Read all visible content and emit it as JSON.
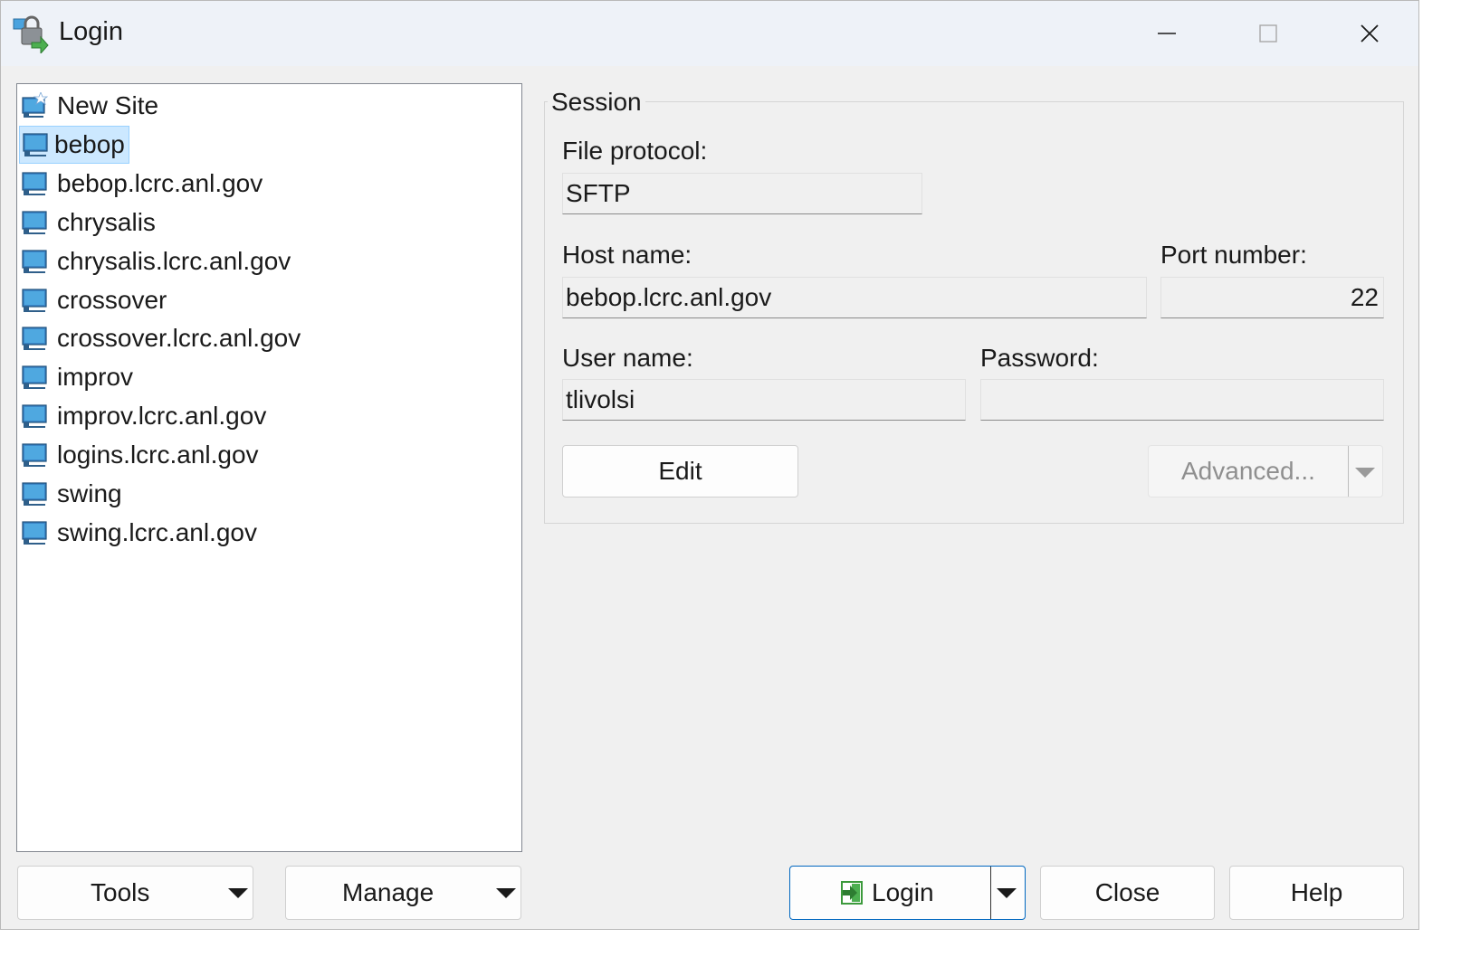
{
  "window": {
    "title": "Login",
    "minimize_icon": "minimize-icon",
    "maximize_icon": "maximize-icon",
    "close_icon": "close-icon"
  },
  "site_tree": {
    "items": [
      {
        "label": "New Site",
        "icon": "new-site-icon"
      },
      {
        "label": "bebop",
        "icon": "computer-icon",
        "selected": true
      },
      {
        "label": "bebop.lcrc.anl.gov",
        "icon": "computer-icon"
      },
      {
        "label": "chrysalis",
        "icon": "computer-icon"
      },
      {
        "label": "chrysalis.lcrc.anl.gov",
        "icon": "computer-icon"
      },
      {
        "label": "crossover",
        "icon": "computer-icon"
      },
      {
        "label": "crossover.lcrc.anl.gov",
        "icon": "computer-icon"
      },
      {
        "label": "improv",
        "icon": "computer-icon"
      },
      {
        "label": "improv.lcrc.anl.gov",
        "icon": "computer-icon"
      },
      {
        "label": "logins.lcrc.anl.gov",
        "icon": "computer-icon"
      },
      {
        "label": "swing",
        "icon": "computer-icon"
      },
      {
        "label": "swing.lcrc.anl.gov",
        "icon": "computer-icon"
      }
    ]
  },
  "session": {
    "legend": "Session",
    "file_protocol_label": "File protocol:",
    "file_protocol_value": "SFTP",
    "host_name_label": "Host name:",
    "host_name_value": "bebop.lcrc.anl.gov",
    "port_number_label": "Port number:",
    "port_number_value": "22",
    "user_name_label": "User name:",
    "user_name_value": "tlivolsi",
    "password_label": "Password:",
    "password_value": "",
    "edit_button": "Edit",
    "advanced_button": "Advanced..."
  },
  "bottom": {
    "tools_button": "Tools",
    "manage_button": "Manage",
    "login_button": "Login",
    "close_button": "Close",
    "help_button": "Help"
  },
  "colors": {
    "selection_bg": "#cce8ff",
    "selection_border": "#99d1ff",
    "login_border": "#0067c0",
    "dialog_bg": "#f0f0f0"
  }
}
